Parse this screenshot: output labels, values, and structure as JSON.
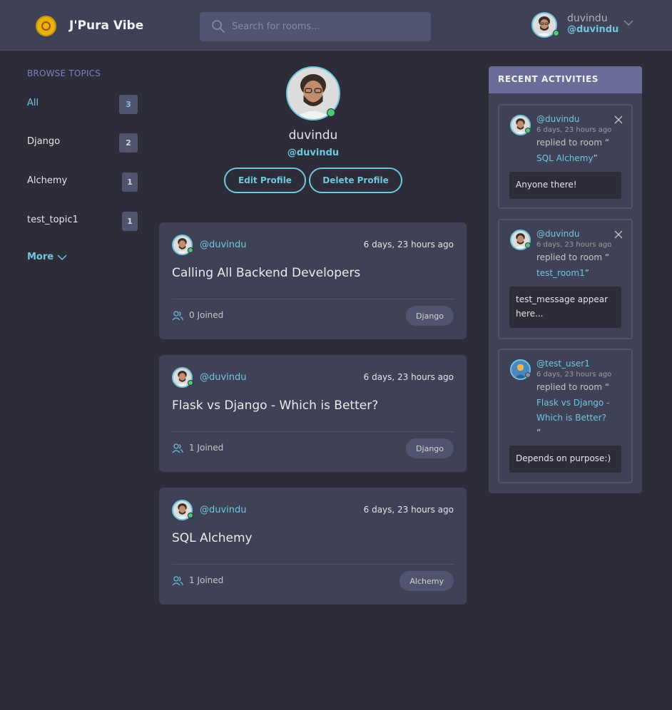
{
  "header": {
    "brand": "J'Pura Vibe",
    "search_placeholder": "Search for rooms...",
    "user_name": "duvindu",
    "user_handle": "@duvindu"
  },
  "sidebar": {
    "title": "BROWSE TOPICS",
    "topics": [
      {
        "label": "All",
        "count": "3"
      },
      {
        "label": "Django",
        "count": "2"
      },
      {
        "label": "Alchemy",
        "count": "1"
      },
      {
        "label": "test_topic1",
        "count": "1"
      }
    ],
    "more_label": "More"
  },
  "profile": {
    "name": "duvindu",
    "handle": "@duvindu",
    "edit_label": "Edit Profile",
    "delete_label": "Delete Profile"
  },
  "rooms": [
    {
      "author": "@duvindu",
      "time": "6 days, 23 hours ago",
      "title": "Calling All Backend Developers",
      "joined": "0 Joined",
      "topic": "Django"
    },
    {
      "author": "@duvindu",
      "time": "6 days, 23 hours ago",
      "title": "Flask vs Django - Which is Better?",
      "joined": "1 Joined",
      "topic": "Django"
    },
    {
      "author": "@duvindu",
      "time": "6 days, 23 hours ago",
      "title": "SQL Alchemy",
      "joined": "1 Joined",
      "topic": "Alchemy"
    }
  ],
  "activities": {
    "title": "RECENT ACTIVITIES",
    "items": [
      {
        "user": "@duvindu",
        "time": "6 days, 23 hours ago",
        "replied": "replied to room “",
        "room": "SQL Alchemy",
        "quote_close": "”",
        "message": "Anyone there!"
      },
      {
        "user": "@duvindu",
        "time": "6 days, 23 hours ago",
        "replied": "replied to room “",
        "room": "test_room1",
        "quote_close": "”",
        "message": "test_message appear here..."
      },
      {
        "user": "@test_user1",
        "time": "6 days, 23 hours ago",
        "replied": "replied to room “",
        "room": "Flask vs Django - Which is Better?",
        "quote_close": "”",
        "message": "Depends on purpose:)"
      }
    ]
  },
  "colors": {
    "accent": "#71c6dd",
    "background": "#2d2d39",
    "card": "#3f4156",
    "header_bar": "#696d97",
    "online": "#4ec97a"
  }
}
